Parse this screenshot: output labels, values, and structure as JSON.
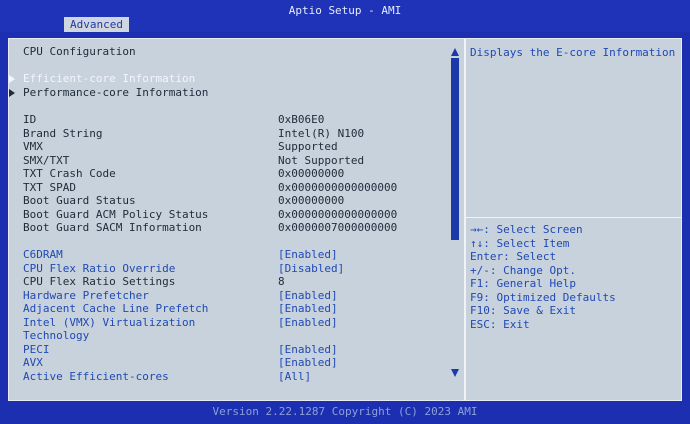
{
  "header": {
    "title": "Aptio Setup - AMI",
    "tab": "Advanced"
  },
  "section_title": "CPU Configuration",
  "submenus": [
    {
      "label": "Efficient-core Information",
      "selected": true
    },
    {
      "label": "Performance-core Information",
      "selected": false
    }
  ],
  "info": [
    {
      "label": "ID",
      "value": "0xB06E0"
    },
    {
      "label": "Brand String",
      "value": "Intel(R) N100"
    },
    {
      "label": "VMX",
      "value": "Supported"
    },
    {
      "label": "SMX/TXT",
      "value": "Not Supported"
    },
    {
      "label": "TXT Crash Code",
      "value": "0x00000000"
    },
    {
      "label": "TXT SPAD",
      "value": "0x0000000000000000"
    },
    {
      "label": "Boot Guard Status",
      "value": "0x00000000"
    },
    {
      "label": "Boot Guard ACM Policy Status",
      "value": "0x0000000000000000"
    },
    {
      "label": "Boot Guard SACM Information",
      "value": "0x0000007000000000"
    }
  ],
  "settings": [
    {
      "label": "C6DRAM",
      "value": "[Enabled]"
    },
    {
      "label": "CPU Flex Ratio Override",
      "value": "[Disabled]"
    },
    {
      "label": "CPU Flex Ratio Settings",
      "value": "8"
    },
    {
      "label": "Hardware Prefetcher",
      "value": "[Enabled]"
    },
    {
      "label": "Adjacent Cache Line Prefetch",
      "value": "[Enabled]"
    },
    {
      "label": "Intel (VMX) Virtualization",
      "value": "[Enabled]"
    },
    {
      "label": "Technology",
      "value": ""
    },
    {
      "label": "PECI",
      "value": "[Enabled]"
    },
    {
      "label": "AVX",
      "value": "[Enabled]"
    },
    {
      "label": "Active Efficient-cores",
      "value": "[All]"
    }
  ],
  "help_text": "Displays the E-core Information",
  "keys": [
    "→←: Select Screen",
    "↑↓: Select Item",
    "Enter: Select",
    "+/-: Change Opt.",
    "F1: General Help",
    "F9: Optimized Defaults",
    "F10: Save & Exit",
    "ESC: Exit"
  ],
  "footer": "Version 2.22.1287 Copyright (C) 2023 AMI"
}
